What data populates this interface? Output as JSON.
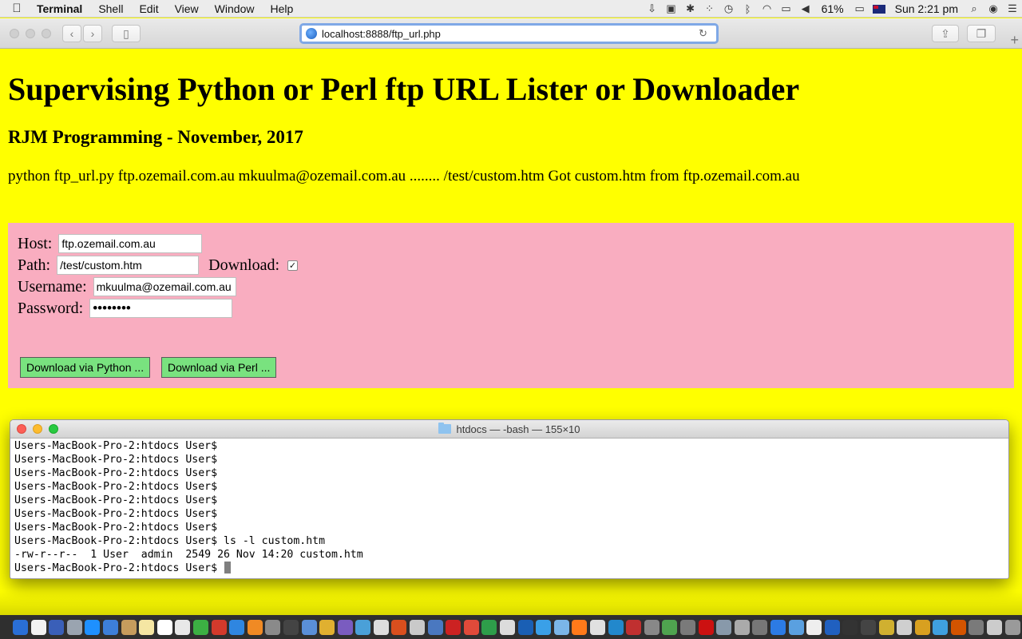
{
  "menubar": {
    "apple": "",
    "app_name": "Terminal",
    "menus": [
      "Shell",
      "Edit",
      "View",
      "Window",
      "Help"
    ],
    "battery": "61%",
    "clock": "Sun 2:21 pm"
  },
  "browser": {
    "url": "localhost:8888/ftp_url.php"
  },
  "page": {
    "title": "Supervising Python or Perl ftp URL Lister or Downloader",
    "subtitle": "RJM Programming - November, 2017",
    "output": "python ftp_url.py ftp.ozemail.com.au mkuulma@ozemail.com.au ........ /test/custom.htm Got custom.htm from ftp.ozemail.com.au",
    "form": {
      "host_label": "Host:",
      "host_value": "ftp.ozemail.com.au",
      "path_label": "Path:",
      "path_value": "/test/custom.htm",
      "download_label": "Download:",
      "download_checked": true,
      "username_label": "Username:",
      "username_value": "mkuulma@ozemail.com.au",
      "password_label": "Password:",
      "password_value": "••••••••",
      "python_button": "Download via Python ...",
      "perl_button": "Download via Perl ..."
    }
  },
  "terminal": {
    "title": "htdocs — -bash — 155×10",
    "lines": [
      "Users-MacBook-Pro-2:htdocs User$",
      "Users-MacBook-Pro-2:htdocs User$",
      "Users-MacBook-Pro-2:htdocs User$",
      "Users-MacBook-Pro-2:htdocs User$",
      "Users-MacBook-Pro-2:htdocs User$",
      "Users-MacBook-Pro-2:htdocs User$",
      "Users-MacBook-Pro-2:htdocs User$",
      "Users-MacBook-Pro-2:htdocs User$ ls -l custom.htm",
      "-rw-r--r--  1 User  admin  2549 26 Nov 14:20 custom.htm",
      "Users-MacBook-Pro-2:htdocs User$ "
    ]
  },
  "dock": {
    "icon_colors": [
      "#2a6fd6",
      "#f2f2f2",
      "#3a5fb8",
      "#9aa4b0",
      "#1e90ff",
      "#3d7fd9",
      "#c69c5d",
      "#f5e6a3",
      "#ffffff",
      "#e8e8e8",
      "#3cb043",
      "#d33a2c",
      "#2f86e0",
      "#f08a24",
      "#8a8a8a",
      "#444444",
      "#5a8fd8",
      "#e0b030",
      "#7a5cc0",
      "#4aa0d8",
      "#dddddd",
      "#d94f1e",
      "#c9c9c9",
      "#4a78c0",
      "#cc2222",
      "#e04a3a",
      "#2e9e4a",
      "#dcdcdc",
      "#1a5fb4",
      "#3aa0e8",
      "#7bb6e8",
      "#ff7a1a",
      "#e0e0e0",
      "#2288cc",
      "#c03030",
      "#888888",
      "#4fa34f",
      "#7a7a7a",
      "#cc1111",
      "#8899aa",
      "#aaaaaa",
      "#777777",
      "#2c7be5",
      "#5aa0e0",
      "#eeeeee",
      "#2060c0",
      "#333333",
      "#444444",
      "#d0b030",
      "#cfcfcf",
      "#d8a020",
      "#3fa0e0",
      "#d35400",
      "#7a7a7a",
      "#cccccc",
      "#9a9a9a",
      "#bbbbbb",
      "#888888"
    ]
  }
}
